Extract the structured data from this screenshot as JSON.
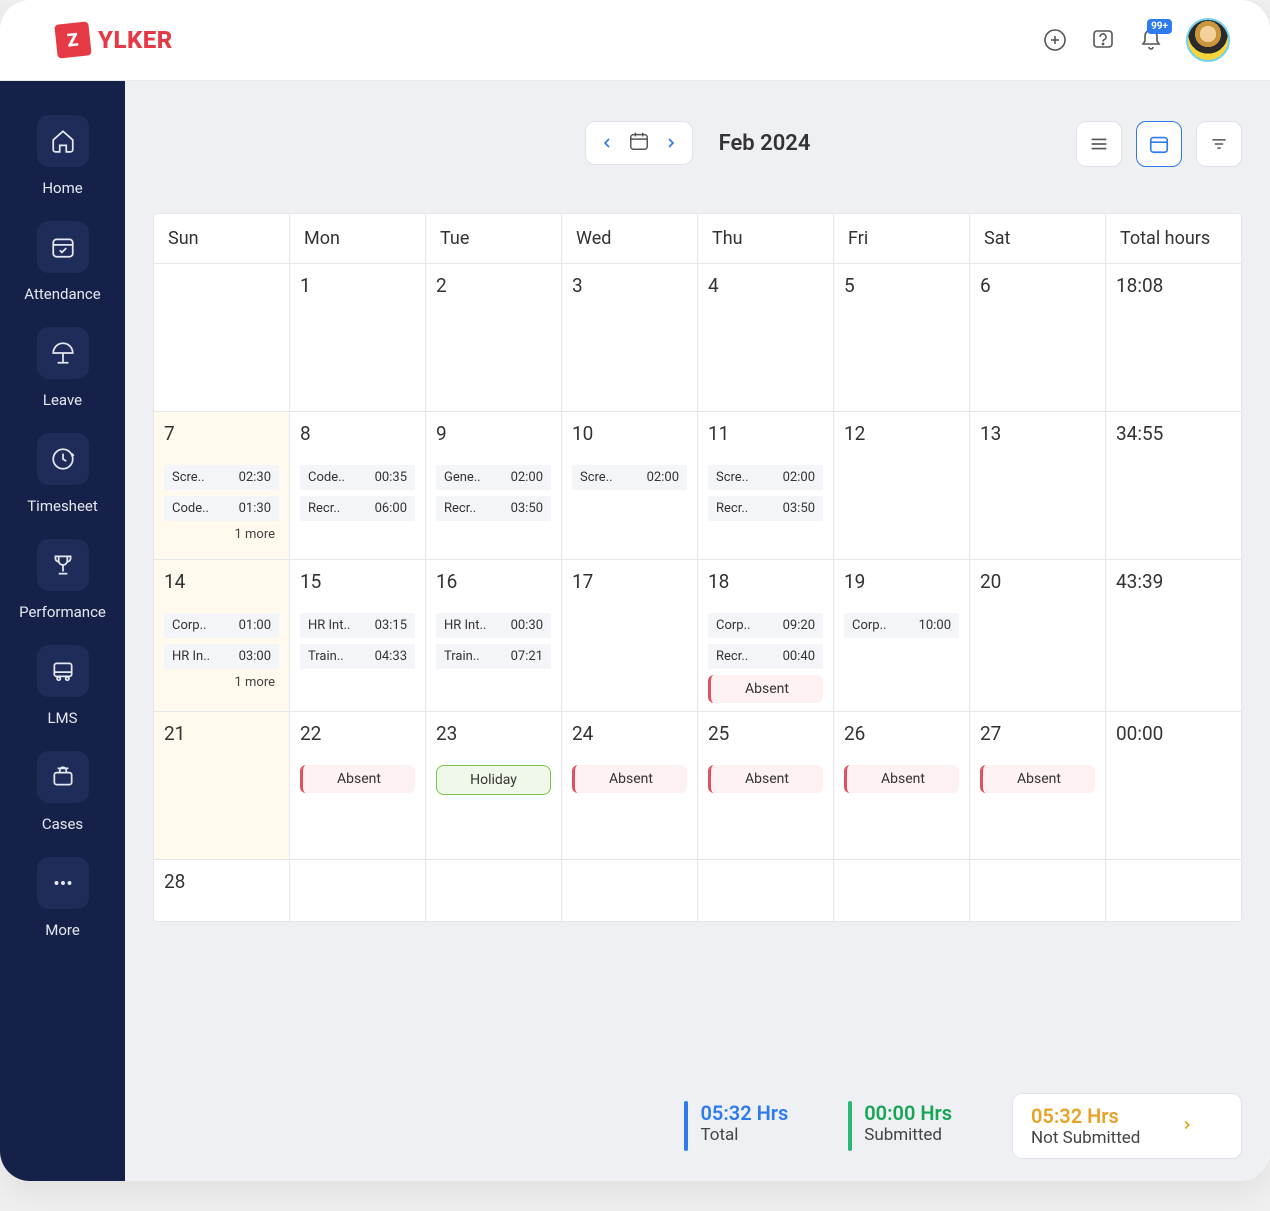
{
  "brand": {
    "badge": "Z",
    "name": "YLKER"
  },
  "header": {
    "notif_badge": "99+"
  },
  "sidebar": {
    "items": [
      {
        "label": "Home"
      },
      {
        "label": "Attendance"
      },
      {
        "label": "Leave"
      },
      {
        "label": "Timesheet"
      },
      {
        "label": "Performance"
      },
      {
        "label": "LMS"
      },
      {
        "label": "Cases"
      },
      {
        "label": "More"
      }
    ]
  },
  "toolbar": {
    "month_label": "Feb 2024"
  },
  "calendar": {
    "headers": [
      "Sun",
      "Mon",
      "Tue",
      "Wed",
      "Thu",
      "Fri",
      "Sat",
      "Total hours"
    ],
    "weeks": [
      {
        "days": [
          {
            "num": ""
          },
          {
            "num": "1"
          },
          {
            "num": "2"
          },
          {
            "num": "3"
          },
          {
            "num": "4"
          },
          {
            "num": "5"
          },
          {
            "num": "6"
          }
        ],
        "total": "18:08"
      },
      {
        "days": [
          {
            "num": "7",
            "highlight": true,
            "entries": [
              {
                "t": "Scre..",
                "h": "02:30"
              },
              {
                "t": "Code..",
                "h": "01:30"
              }
            ],
            "more": "1 more"
          },
          {
            "num": "8",
            "entries": [
              {
                "t": "Code..",
                "h": "00:35"
              },
              {
                "t": "Recr..",
                "h": "06:00"
              }
            ]
          },
          {
            "num": "9",
            "entries": [
              {
                "t": "Gene..",
                "h": "02:00"
              },
              {
                "t": "Recr..",
                "h": "03:50"
              }
            ]
          },
          {
            "num": "10",
            "entries": [
              {
                "t": "Scre..",
                "h": "02:00"
              }
            ]
          },
          {
            "num": "11",
            "entries": [
              {
                "t": "Scre..",
                "h": "02:00"
              },
              {
                "t": "Recr..",
                "h": "03:50"
              }
            ]
          },
          {
            "num": "12"
          },
          {
            "num": "13"
          }
        ],
        "total": "34:55"
      },
      {
        "days": [
          {
            "num": "14",
            "highlight": true,
            "entries": [
              {
                "t": "Corp..",
                "h": "01:00"
              },
              {
                "t": "HR In..",
                "h": "03:00"
              }
            ],
            "more": "1 more"
          },
          {
            "num": "15",
            "entries": [
              {
                "t": "HR Int..",
                "h": "03:15"
              },
              {
                "t": "Train..",
                "h": "04:33"
              }
            ]
          },
          {
            "num": "16",
            "entries": [
              {
                "t": "HR Int..",
                "h": "00:30"
              },
              {
                "t": "Train..",
                "h": "07:21"
              }
            ]
          },
          {
            "num": "17"
          },
          {
            "num": "18",
            "entries": [
              {
                "t": "Corp..",
                "h": "09:20"
              },
              {
                "t": "Recr..",
                "h": "00:40"
              }
            ],
            "badge": {
              "type": "absent",
              "label": "Absent"
            }
          },
          {
            "num": "19",
            "entries": [
              {
                "t": "Corp..",
                "h": "10:00"
              }
            ]
          },
          {
            "num": "20"
          }
        ],
        "total": "43:39"
      },
      {
        "days": [
          {
            "num": "21",
            "highlight": true
          },
          {
            "num": "22",
            "badge": {
              "type": "absent",
              "label": "Absent"
            }
          },
          {
            "num": "23",
            "badge": {
              "type": "holiday",
              "label": "Holiday"
            }
          },
          {
            "num": "24",
            "badge": {
              "type": "absent",
              "label": "Absent"
            }
          },
          {
            "num": "25",
            "badge": {
              "type": "absent",
              "label": "Absent"
            }
          },
          {
            "num": "26",
            "badge": {
              "type": "absent",
              "label": "Absent"
            }
          },
          {
            "num": "27",
            "badge": {
              "type": "absent",
              "label": "Absent"
            }
          }
        ],
        "total": "00:00"
      },
      {
        "short": true,
        "days": [
          {
            "num": "28"
          },
          {
            "num": ""
          },
          {
            "num": ""
          },
          {
            "num": ""
          },
          {
            "num": ""
          },
          {
            "num": ""
          },
          {
            "num": ""
          }
        ],
        "total": ""
      }
    ]
  },
  "summary": {
    "total": {
      "value": "05:32 Hrs",
      "label": "Total"
    },
    "submitted": {
      "value": "00:00 Hrs",
      "label": "Submitted"
    },
    "not_submitted": {
      "value": "05:32 Hrs",
      "label": "Not Submitted"
    }
  }
}
